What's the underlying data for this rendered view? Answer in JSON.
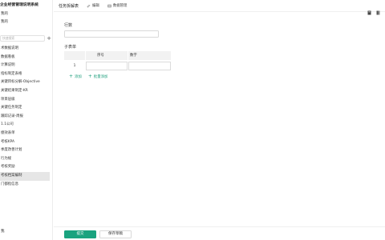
{
  "sidebar": {
    "brand": "企业经营管理说明系统",
    "top_items": [
      "我的",
      "我的"
    ],
    "search_placeholder": "快速搜索",
    "add_label": "+",
    "items": [
      "术数据说明",
      "数据看板",
      "计算说明",
      "指标制定表格",
      "关键目标分解-Objective",
      "关键结果制定-KR",
      "项目层级",
      "关键任务制定",
      "跟踪记录-周报",
      "1.1公司",
      "绩效表单",
      "考核KPA",
      "季度改善计划",
      "行为规",
      "考核奖励",
      "考核档案编制",
      "门都指信息"
    ],
    "active_index": 15,
    "bottom_item": "我"
  },
  "topbar": {
    "title": "任务拆解表",
    "edit_label": "编辑",
    "data_label": "数据管理"
  },
  "form": {
    "field_label": "行数",
    "subtable_label": "子表单",
    "columns": [
      "序号",
      "数字"
    ],
    "row_number": "1",
    "add_label": "添加",
    "batch_add_label": "批量添加"
  },
  "footer": {
    "submit_label": "提交",
    "save_draft_label": "保存草稿"
  }
}
